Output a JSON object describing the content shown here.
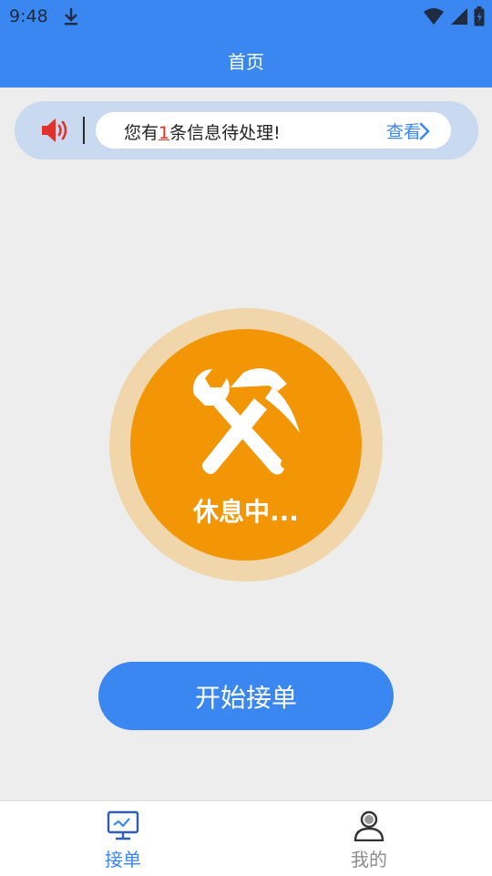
{
  "status_bar": {
    "time": "9:48",
    "icons": [
      "download-icon",
      "wifi-icon",
      "signal-icon",
      "battery-icon"
    ]
  },
  "header": {
    "title": "首页"
  },
  "notice": {
    "prefix": "您有",
    "count": "1",
    "suffix": "条信息待处理!",
    "view_label": "查看",
    "icon": "speaker-icon"
  },
  "work_status": {
    "label": "休息中...",
    "icon": "tools-icon"
  },
  "start_button": {
    "label": "开始接单"
  },
  "tabs": [
    {
      "label": "接单",
      "icon": "monitor-icon",
      "active": true
    },
    {
      "label": "我的",
      "icon": "user-icon",
      "active": false
    }
  ],
  "colors": {
    "primary": "#3a87f2",
    "accent_orange": "#f39605",
    "ring": "#f0d6aa",
    "notice_bg": "#c9d9f0",
    "alert_red": "#e0312c"
  }
}
